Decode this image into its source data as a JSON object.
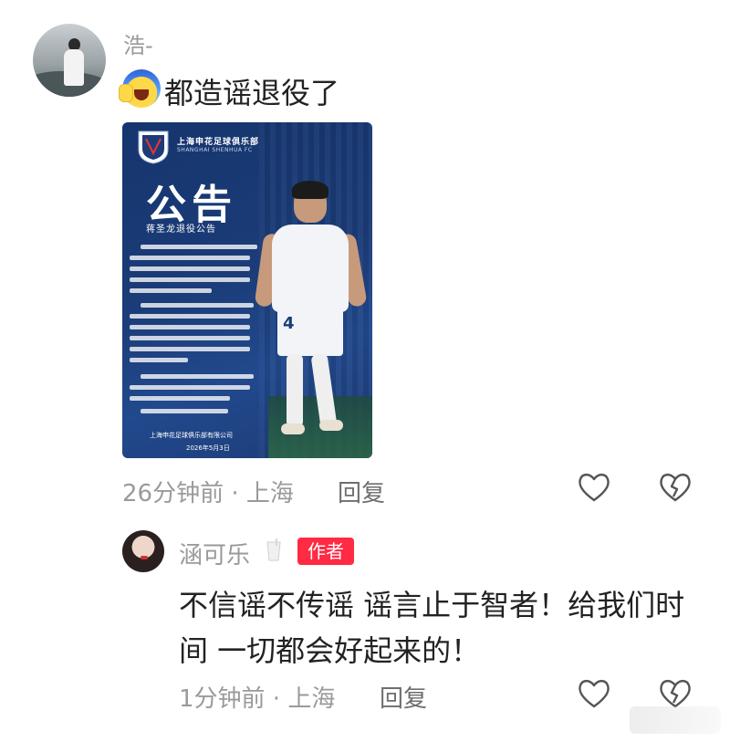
{
  "comment": {
    "username": "浩-",
    "text": "都造谣退役了",
    "meta": "26分钟前 · 上海",
    "reply_label": "回复",
    "emoji": "crying-face-with-hand-emoji"
  },
  "poster": {
    "club_cn": "上海申花足球俱乐部",
    "club_en": "SHANGHAI SHENHUA FC",
    "headline": "公告",
    "subtitle": "蒋圣龙退役公告",
    "signoff": "上海申花足球俱乐部有限公司",
    "date": "2026年5月3日",
    "jersey_number": "4"
  },
  "reply": {
    "username": "涵可乐",
    "badge": "作者",
    "text": "不信谣不传谣 谣言止于智者！给我们时间 一切都会好起来的！",
    "meta": "1分钟前 · 上海",
    "reply_label": "回复"
  },
  "icons": {
    "like": "heart-outline-icon",
    "dislike": "broken-heart-icon"
  },
  "colors": {
    "badge_red": "#ff2a43",
    "poster_blue": "#1b3c78",
    "meta_gray": "#9a9a9a"
  }
}
